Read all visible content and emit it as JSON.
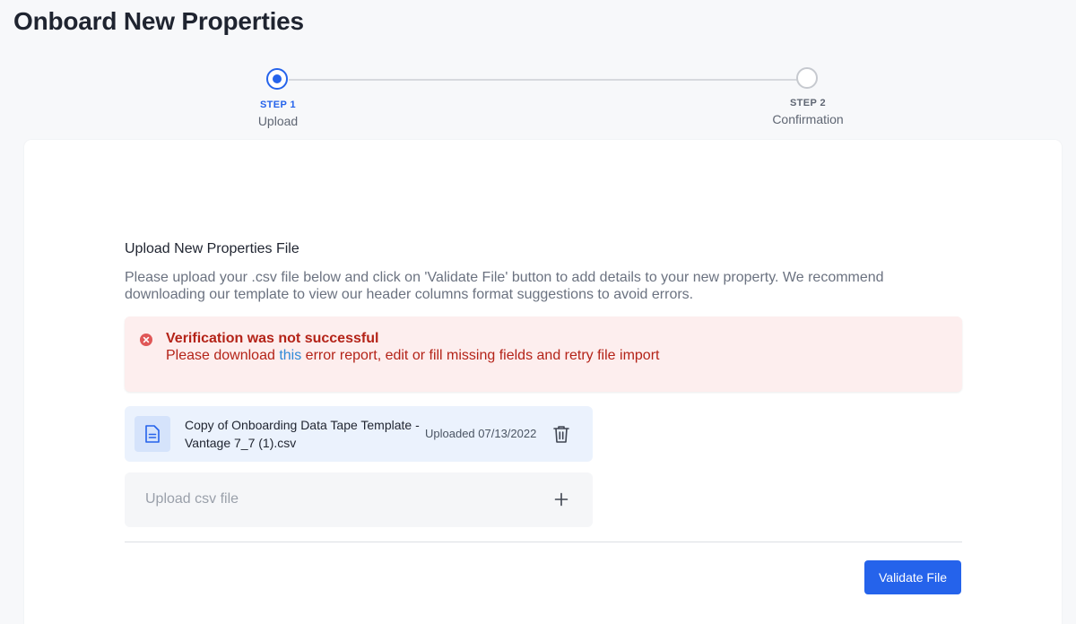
{
  "page": {
    "title": "Onboard New Properties"
  },
  "stepper": {
    "steps": [
      {
        "label": "STEP 1",
        "name": "Upload",
        "active": true
      },
      {
        "label": "STEP 2",
        "name": "Confirmation",
        "active": false
      }
    ]
  },
  "upload_section": {
    "title": "Upload New Properties File",
    "description": "Please upload your .csv file below and click on 'Validate File' button to add details to your new property. We recommend downloading our template to view our header columns format suggestions to avoid errors."
  },
  "alert": {
    "title": "Verification was not successful",
    "message_prefix": "Please download ",
    "link_text": "this",
    "message_suffix": " error report, edit or fill missing fields and retry file import",
    "icon": "error-circle-icon"
  },
  "file": {
    "name": "Copy of Onboarding Data Tape Template - Vantage 7_7 (1).csv",
    "uploaded": "Uploaded 07/13/2022",
    "icon": "document-icon",
    "delete_icon": "trash-icon"
  },
  "upload_field": {
    "placeholder": "Upload csv file",
    "icon": "plus-icon"
  },
  "actions": {
    "validate_label": "Validate File"
  },
  "colors": {
    "primary": "#2563eb",
    "error_bg": "#fdeeee",
    "error_text": "#b42318",
    "link": "#2f8ad8",
    "file_bg": "#ebf2fd"
  }
}
